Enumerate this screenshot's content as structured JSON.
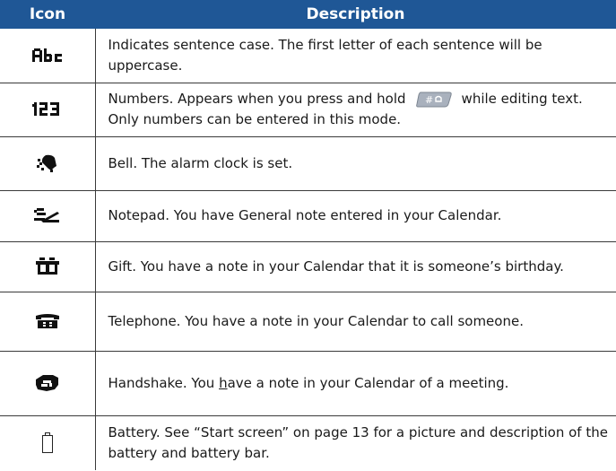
{
  "header": {
    "icon": "Icon",
    "description": "Description"
  },
  "rows": [
    {
      "icon": "abc-text-mode-icon",
      "description": "Indicates sentence case. The first letter of each sentence will be uppercase."
    },
    {
      "icon": "123-number-mode-icon",
      "description_before": "Numbers. Appears when you press and hold",
      "key_icon": "hash-key-icon",
      "description_after": "while editing text. Only numbers can be entered in this mode."
    },
    {
      "icon": "bell-icon",
      "description": "Bell. The alarm clock is set."
    },
    {
      "icon": "notepad-icon",
      "description": "Notepad. You have General note entered in your Calendar."
    },
    {
      "icon": "gift-icon",
      "description": "Gift. You have a note in your Calendar that it is someone’s birthday."
    },
    {
      "icon": "telephone-icon",
      "description": "Telephone. You have a note in your Calendar to call someone."
    },
    {
      "icon": "handshake-icon",
      "description_before": "Handshake. You ",
      "description_u": "h",
      "description_after": "ave a note in your Calendar of a meeting."
    },
    {
      "icon": "battery-icon",
      "description": "Battery. See “Start screen” on page 13 for a picture and description of the battery and battery bar."
    }
  ]
}
